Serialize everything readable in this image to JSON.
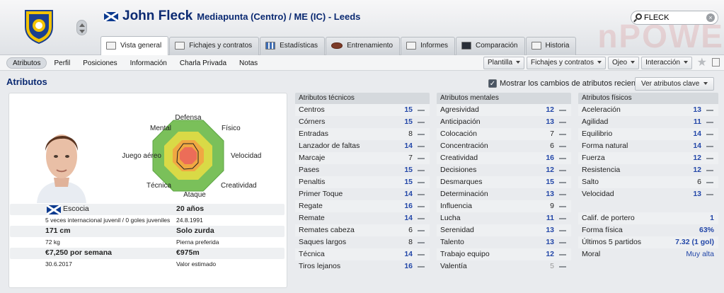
{
  "header": {
    "player_name": "John Fleck",
    "position_club": "Mediapunta (Centro) / ME (IC) - Leeds",
    "search_value": "FLECK",
    "watermark": "nPOWE"
  },
  "tabs": [
    "Vista general",
    "Fichajes y contratos",
    "Estadísticas",
    "Entrenamiento",
    "Informes",
    "Comparación",
    "Historia"
  ],
  "subnav": [
    "Atributos",
    "Perfil",
    "Posiciones",
    "Información",
    "Charla Privada",
    "Notas"
  ],
  "dropdowns": [
    "Plantilla",
    "Fichajes y contratos",
    "Ojeo",
    "Interacción"
  ],
  "section_title": "Atributos",
  "recent_changes_label": "Mostrar los cambios de atributos recientes",
  "key_attributes_button": "Ver atributos clave",
  "radar": {
    "labels": {
      "top": "Defensa",
      "top_right": "Físico",
      "right": "Velocidad",
      "bottom_right": "Creatividad",
      "bottom": "Ataque",
      "bottom_left": "Técnica",
      "left": "Juego aéreo",
      "top_left": "Mental"
    }
  },
  "profile": {
    "nationality": "Escocia",
    "age": "20 años",
    "youth_caps": "5 veces internacional juvenil / 0 goles juveniles",
    "dob": "24.8.1991",
    "height": "171 cm",
    "foot": "Solo zurda",
    "weight": "72 kg",
    "foot_label": "Pierna preferida",
    "wage": "€7,250 por semana",
    "value": "€975m",
    "contract_end": "30.6.2017",
    "value_label": "Valor estimado"
  },
  "technical": {
    "title": "Atributos técnicos",
    "items": [
      {
        "name": "Centros",
        "value": "15"
      },
      {
        "name": "Córners",
        "value": "15"
      },
      {
        "name": "Entradas",
        "value": "8"
      },
      {
        "name": "Lanzador de faltas",
        "value": "14"
      },
      {
        "name": "Marcaje",
        "value": "7"
      },
      {
        "name": "Pases",
        "value": "15"
      },
      {
        "name": "Penaltis",
        "value": "15"
      },
      {
        "name": "Primer Toque",
        "value": "14"
      },
      {
        "name": "Regate",
        "value": "16"
      },
      {
        "name": "Remate",
        "value": "14"
      },
      {
        "name": "Remates cabeza",
        "value": "6"
      },
      {
        "name": "Saques largos",
        "value": "8"
      },
      {
        "name": "Técnica",
        "value": "14"
      },
      {
        "name": "Tiros lejanos",
        "value": "16"
      }
    ]
  },
  "mental": {
    "title": "Atributos mentales",
    "items": [
      {
        "name": "Agresividad",
        "value": "12"
      },
      {
        "name": "Anticipación",
        "value": "13"
      },
      {
        "name": "Colocación",
        "value": "7"
      },
      {
        "name": "Concentración",
        "value": "6"
      },
      {
        "name": "Creatividad",
        "value": "16"
      },
      {
        "name": "Decisiones",
        "value": "12"
      },
      {
        "name": "Desmarques",
        "value": "15"
      },
      {
        "name": "Determinación",
        "value": "13"
      },
      {
        "name": "Influencia",
        "value": "9"
      },
      {
        "name": "Lucha",
        "value": "11"
      },
      {
        "name": "Serenidad",
        "value": "13"
      },
      {
        "name": "Talento",
        "value": "13"
      },
      {
        "name": "Trabajo equipo",
        "value": "12"
      },
      {
        "name": "Valentía",
        "value": "5"
      }
    ]
  },
  "physical": {
    "title": "Atributos físicos",
    "items": [
      {
        "name": "Aceleración",
        "value": "13"
      },
      {
        "name": "Agilidad",
        "value": "11"
      },
      {
        "name": "Equilibrio",
        "value": "14"
      },
      {
        "name": "Forma natural",
        "value": "14"
      },
      {
        "name": "Fuerza",
        "value": "12"
      },
      {
        "name": "Resistencia",
        "value": "12"
      },
      {
        "name": "Salto",
        "value": "6"
      },
      {
        "name": "Velocidad",
        "value": "13"
      }
    ]
  },
  "extra": [
    {
      "name": "Calif. de portero",
      "value": "1"
    },
    {
      "name": "Forma física",
      "value": "63%"
    },
    {
      "name": "Últimos 5 partidos",
      "value": "7.32 (1 gol)"
    },
    {
      "name": "Moral",
      "value": "Muy alta"
    }
  ],
  "colors": {
    "accent": "#0b2a72",
    "value_blue": "#2347a8"
  }
}
